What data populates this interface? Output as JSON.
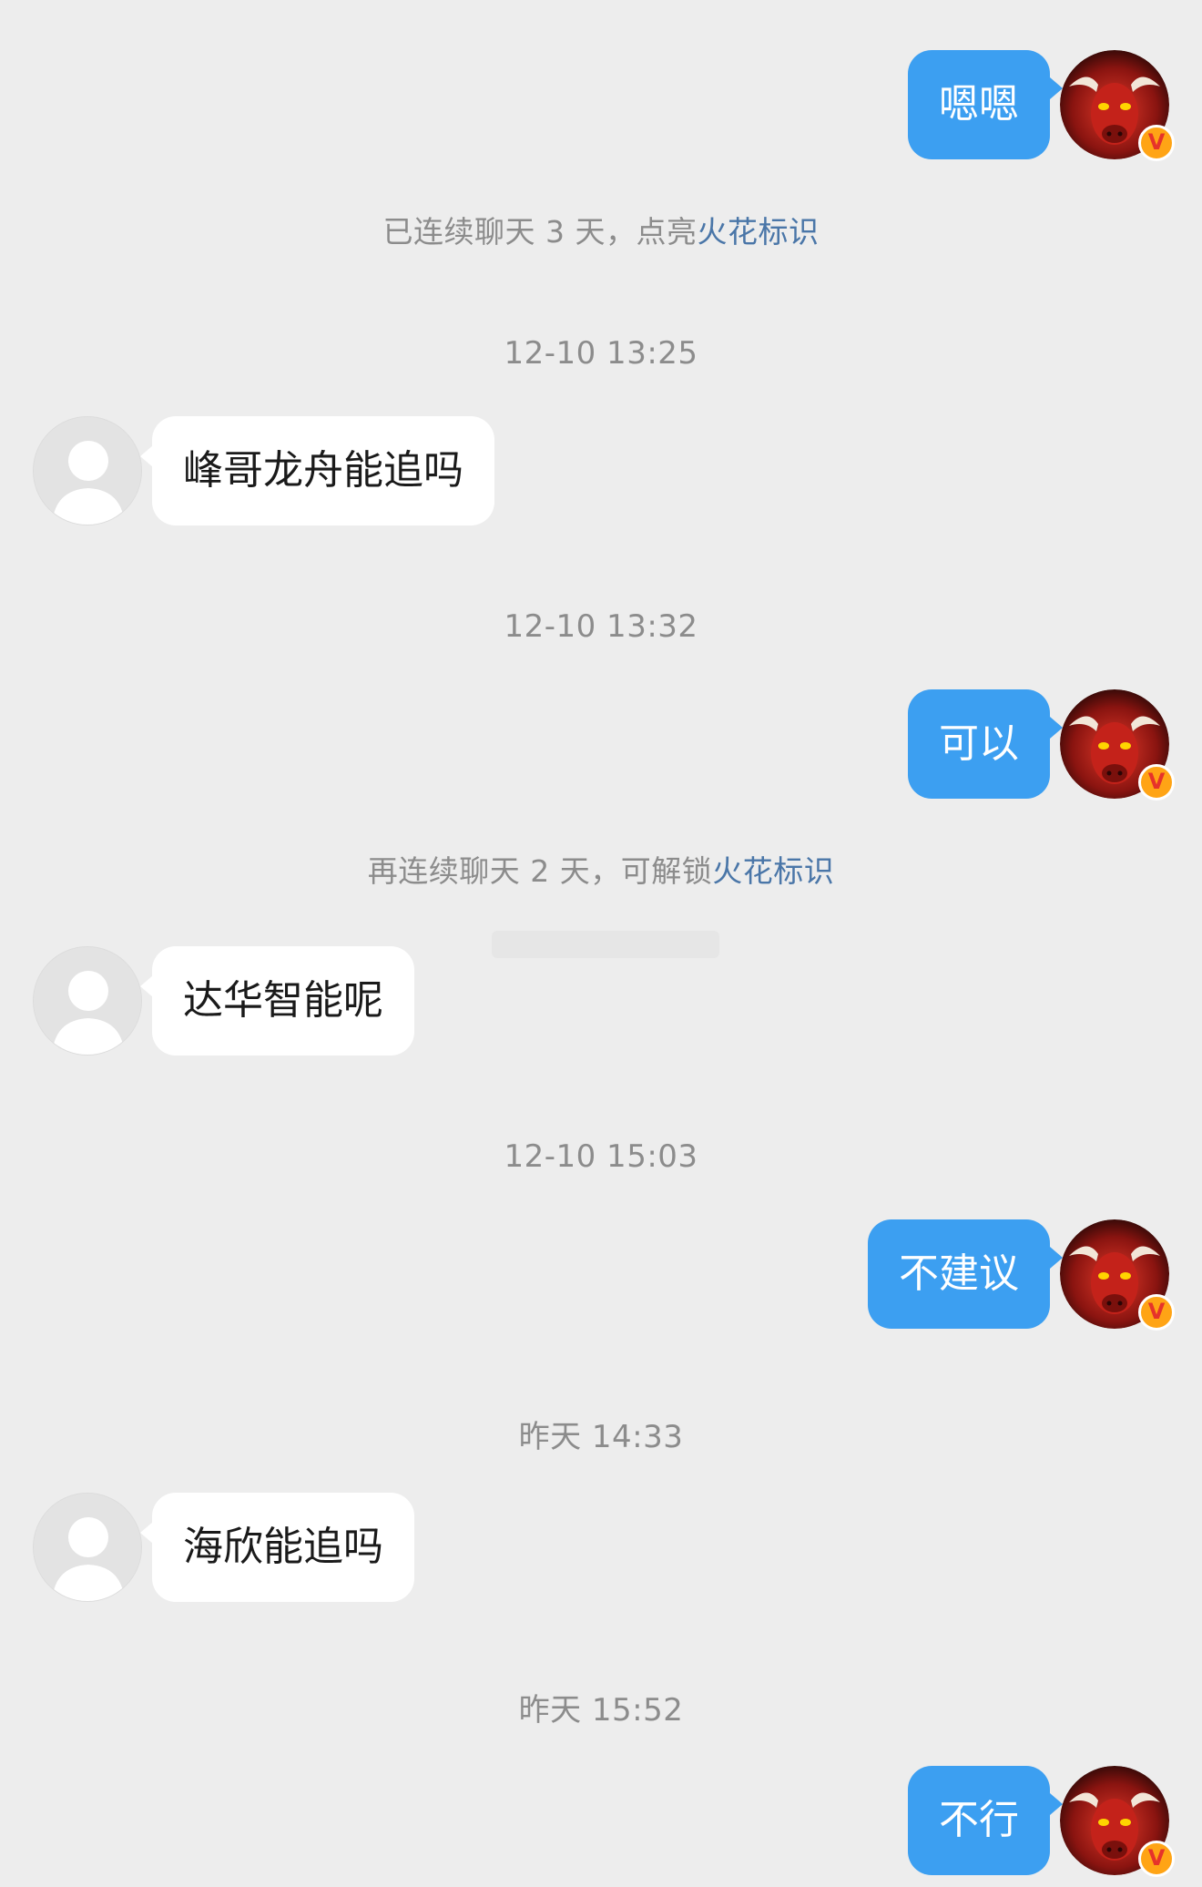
{
  "messages": [
    {
      "side": "out",
      "text": "嗯嗯"
    },
    {
      "type": "system",
      "prefix": "已连续聊天 3 天，点亮",
      "highlight": "火花标识"
    },
    {
      "type": "time",
      "text": "12-10 13:25"
    },
    {
      "side": "in",
      "text": "峰哥龙舟能追吗"
    },
    {
      "type": "time",
      "text": "12-10 13:32"
    },
    {
      "side": "out",
      "text": "可以"
    },
    {
      "type": "system",
      "prefix": "再连续聊天 2 天，可解锁",
      "highlight": "火花标识"
    },
    {
      "side": "in",
      "text": "达华智能呢"
    },
    {
      "type": "time",
      "text": "12-10 15:03"
    },
    {
      "side": "out",
      "text": "不建议"
    },
    {
      "type": "time",
      "text": "昨天 14:33"
    },
    {
      "side": "in",
      "text": "海欣能追吗"
    },
    {
      "type": "time",
      "text": "昨天 15:52"
    },
    {
      "side": "out",
      "text": "不行"
    }
  ],
  "colors": {
    "background": "#ededed",
    "outgoing_bubble": "#3c9ff1",
    "incoming_bubble": "#ffffff",
    "highlight_link": "#4a76a8",
    "meta_text": "#8c8c8c"
  },
  "badge": {
    "label": "V"
  },
  "icons": {
    "self_avatar": "red-bull-avatar",
    "other_avatar": "default-person-avatar",
    "badge": "verified-v-icon"
  }
}
